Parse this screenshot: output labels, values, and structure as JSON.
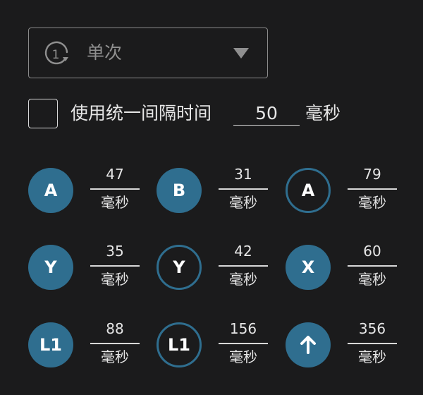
{
  "mode": {
    "icon": "repeat-once-icon",
    "icon_digit": "1",
    "label": "单次"
  },
  "interval": {
    "checked": false,
    "label": "使用统一间隔时间",
    "value": "50",
    "unit": "毫秒"
  },
  "colors": {
    "background": "#1b1b1c",
    "accent": "#2f6e8f",
    "text": "#e6e6e6",
    "muted": "#8f8f8f"
  },
  "steps": [
    {
      "label": "A",
      "style": "filled",
      "duration": "47",
      "unit": "毫秒"
    },
    {
      "label": "B",
      "style": "filled",
      "duration": "31",
      "unit": "毫秒"
    },
    {
      "label": "A",
      "style": "outline",
      "duration": "79",
      "unit": "毫秒"
    },
    {
      "label": "Y",
      "style": "filled",
      "duration": "35",
      "unit": "毫秒"
    },
    {
      "label": "Y",
      "style": "outline",
      "duration": "42",
      "unit": "毫秒"
    },
    {
      "label": "X",
      "style": "filled",
      "duration": "60",
      "unit": "毫秒"
    },
    {
      "label": "L1",
      "style": "filled",
      "duration": "88",
      "unit": "毫秒"
    },
    {
      "label": "L1",
      "style": "outline",
      "duration": "156",
      "unit": "毫秒"
    },
    {
      "label": "",
      "icon": "arrow-up-icon",
      "style": "filled",
      "duration": "356",
      "unit": "毫秒"
    }
  ]
}
